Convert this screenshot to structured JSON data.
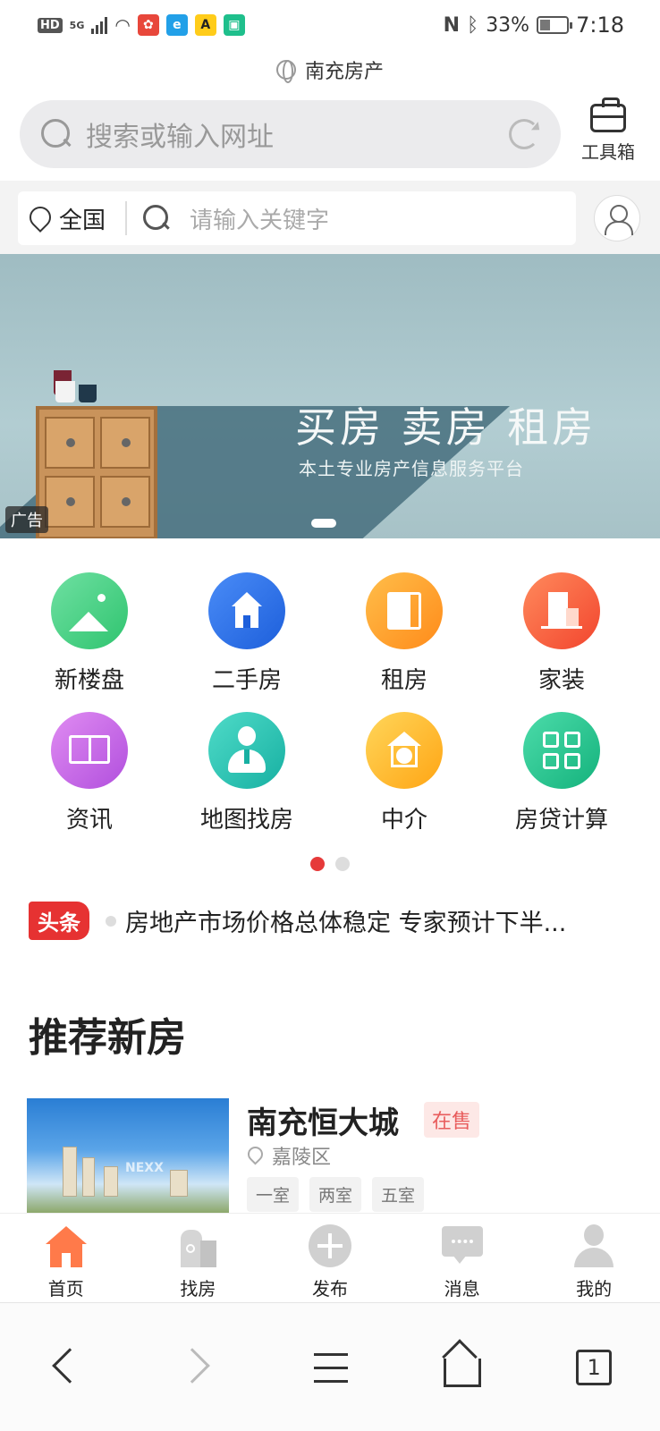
{
  "status_bar": {
    "hd": "HD",
    "network": "5G",
    "battery": "33%",
    "time": "7:18"
  },
  "browser": {
    "site_title": "南充房产",
    "search_placeholder": "搜索或输入网址",
    "toolbox_label": "工具箱",
    "tab_count": "1"
  },
  "site_header": {
    "city": "全国",
    "keyword_placeholder": "请输入关键字"
  },
  "banner": {
    "title": "买房  卖房  租房",
    "subtitle": "本土专业房产信息服务平台",
    "ad_label": "广告"
  },
  "categories": [
    {
      "label": "新楼盘",
      "icon": "mountain-icon",
      "color": "#3ecf7b"
    },
    {
      "label": "二手房",
      "icon": "house-icon",
      "color": "#2a6fe6"
    },
    {
      "label": "租房",
      "icon": "door-icon",
      "color": "#ff9a1f"
    },
    {
      "label": "家装",
      "icon": "furniture-icon",
      "color": "#ff5a3c"
    },
    {
      "label": "资讯",
      "icon": "book-icon",
      "color": "#c15de0"
    },
    {
      "label": "地图找房",
      "icon": "agent-icon",
      "color": "#23c2b3"
    },
    {
      "label": "中介",
      "icon": "home-yuan-icon",
      "color": "#ffb51e"
    },
    {
      "label": "房贷计算",
      "icon": "calculator-icon",
      "color": "#21c08d"
    }
  ],
  "headline": {
    "badge": "头条",
    "text": "房地产市场价格总体稳定 专家预计下半..."
  },
  "section_title": "推荐新房",
  "listing": {
    "name": "南充恒大城",
    "status": "在售",
    "district": "嘉陵区",
    "tags": [
      "一室",
      "两室",
      "五室"
    ],
    "thumb_watermark": "NEXX"
  },
  "tabbar": [
    {
      "label": "首页",
      "icon": "home-icon",
      "active": true
    },
    {
      "label": "找房",
      "icon": "building-search-icon",
      "active": false
    },
    {
      "label": "发布",
      "icon": "plus-circle-icon",
      "active": false
    },
    {
      "label": "消息",
      "icon": "chat-icon",
      "active": false
    },
    {
      "label": "我的",
      "icon": "user-icon",
      "active": false
    }
  ],
  "colors": {
    "accent_red": "#e63a3a",
    "home_orange": "#ff7a4a"
  }
}
